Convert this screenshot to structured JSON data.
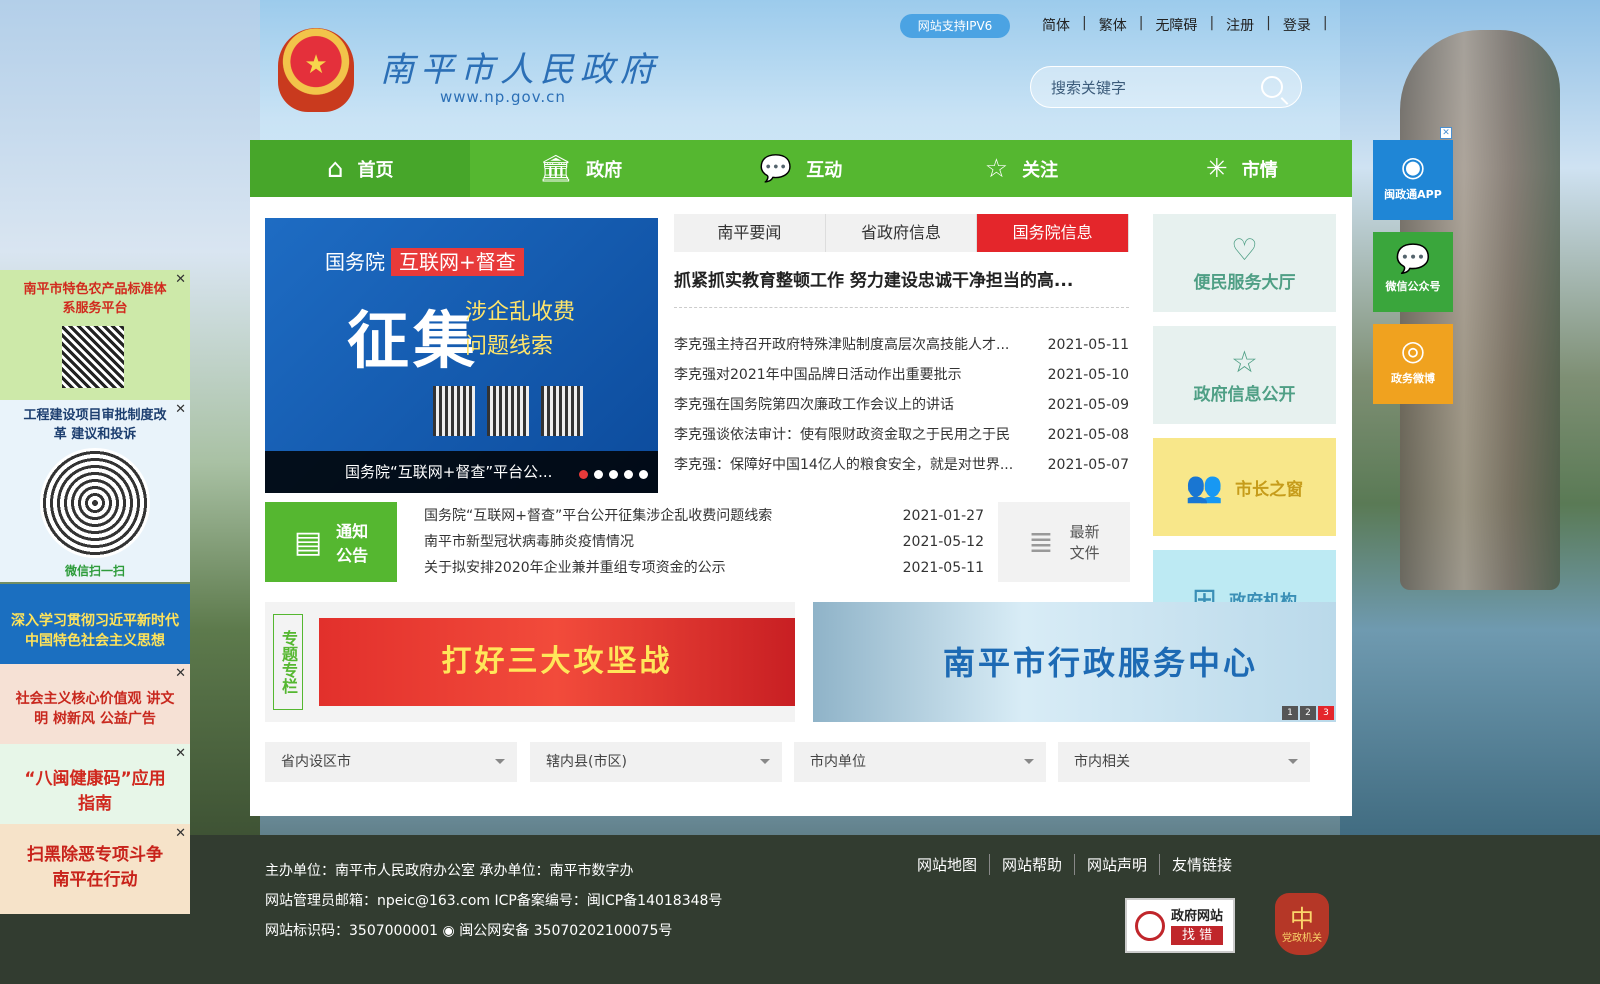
{
  "header": {
    "site_title": "南平市人民政府",
    "site_url": "www.np.gov.cn",
    "ipv6_badge": "网站支持IPV6",
    "top_links": [
      "简体",
      "繁体",
      "无障碍",
      "注册",
      "登录"
    ],
    "search_placeholder": "搜索关键字"
  },
  "nav": {
    "items": [
      {
        "label": "首页",
        "icon": "home-icon",
        "active": true
      },
      {
        "label": "政府",
        "icon": "building-icon"
      },
      {
        "label": "互动",
        "icon": "chat-icon"
      },
      {
        "label": "关注",
        "icon": "star-icon"
      },
      {
        "label": "市情",
        "icon": "bamboo-icon"
      }
    ]
  },
  "banner": {
    "line1": "国务院",
    "line1_tag": "互联网+督查",
    "big": "征集",
    "sub1": "涉企乱收费",
    "sub2": "问题线索",
    "caption": "国务院“互联网+督查”平台公...",
    "active_dot": 0,
    "dot_count": 5
  },
  "news": {
    "tabs": [
      "南平要闻",
      "省政府信息",
      "国务院信息"
    ],
    "active_tab": 2,
    "headline": "抓紧抓实教育整顿工作 努力建设忠诚干净担当的高...",
    "items": [
      {
        "title": "李克强主持召开政府特殊津贴制度高层次高技能人才...",
        "date": "2021-05-11"
      },
      {
        "title": "李克强对2021年中国品牌日活动作出重要批示",
        "date": "2021-05-10"
      },
      {
        "title": "李克强在国务院第四次廉政工作会议上的讲话",
        "date": "2021-05-09"
      },
      {
        "title": "李克强谈依法审计：使有限财政资金取之于民用之于民",
        "date": "2021-05-08"
      },
      {
        "title": "李克强：保障好中国14亿人的粮食安全，就是对世界...",
        "date": "2021-05-07"
      }
    ]
  },
  "side": {
    "service_hall": "便民服务大厅",
    "info_public": "政府信息公开",
    "mayor_window": "市长之窗",
    "gov_org": "政府机构"
  },
  "notice": {
    "tag_line1": "通知",
    "tag_line2": "公告",
    "items": [
      {
        "title": "国务院“互联网+督查”平台公开征集涉企乱收费问题线索",
        "date": "2021-01-27"
      },
      {
        "title": "南平市新型冠状病毒肺炎疫情情况",
        "date": "2021-05-12"
      },
      {
        "title": "关于拟安排2020年企业兼并重组专项资金的公示",
        "date": "2021-05-11"
      }
    ],
    "latest_line1": "最新",
    "latest_line2": "文件"
  },
  "topic": {
    "label": "专题专栏",
    "banner_text": "打好三大攻坚战"
  },
  "service_center": {
    "text": "南平市行政服务中心",
    "pages": [
      "1",
      "2",
      "3"
    ],
    "active_page": 2
  },
  "selects": [
    "省内设区市",
    "辖内县(市区)",
    "市内单位",
    "市内相关"
  ],
  "right_floats": [
    {
      "label": "闽政通APP",
      "icon": "app-icon",
      "color": "#1f86d6"
    },
    {
      "label": "微信公众号",
      "icon": "wechat-icon",
      "color": "#3aa63c"
    },
    {
      "label": "政务微博",
      "icon": "weibo-icon",
      "color": "#f0a21f"
    }
  ],
  "left_ads": [
    {
      "text": "南平市特色农产品标准体系服务平台",
      "bg": "#cde9a9",
      "color": "#d12a1e"
    },
    {
      "text": "工程建设项目审批制度改革 建议和投诉",
      "sub": "微信扫一扫",
      "bg": "#e9f3fa",
      "color": "#1c3e6f"
    },
    {
      "text": "深入学习贯彻习近平新时代中国特色社会主义思想",
      "bg": "#1b6fc0",
      "color": "#ffe35a"
    },
    {
      "text": "社会主义核心价值观 讲文明 树新风 公益广告",
      "bg": "#f6e1d5",
      "color": "#c8281e"
    },
    {
      "text": "“八闽健康码”应用指南",
      "bg": "#e7f6e8",
      "color": "#d0281e"
    },
    {
      "text": "扫黑除恶专项斗争 南平在行动",
      "bg": "#f6e3c9",
      "color": "#c8231b"
    }
  ],
  "footer": {
    "line1": "主办单位：南平市人民政府办公室 承办单位：南平市数字办",
    "line2": "网站管理员邮箱：npeic@163.com ICP备案编号：闽ICP备14018348号",
    "line3a": "网站标识码：3507000001",
    "line3b": "闽公网安备 35070202100075号",
    "links": [
      "网站地图",
      "网站帮助",
      "网站声明",
      "友情链接"
    ],
    "find_error_line1": "政府网站",
    "find_error_line2": "找 错",
    "party_label": "党政机关"
  }
}
